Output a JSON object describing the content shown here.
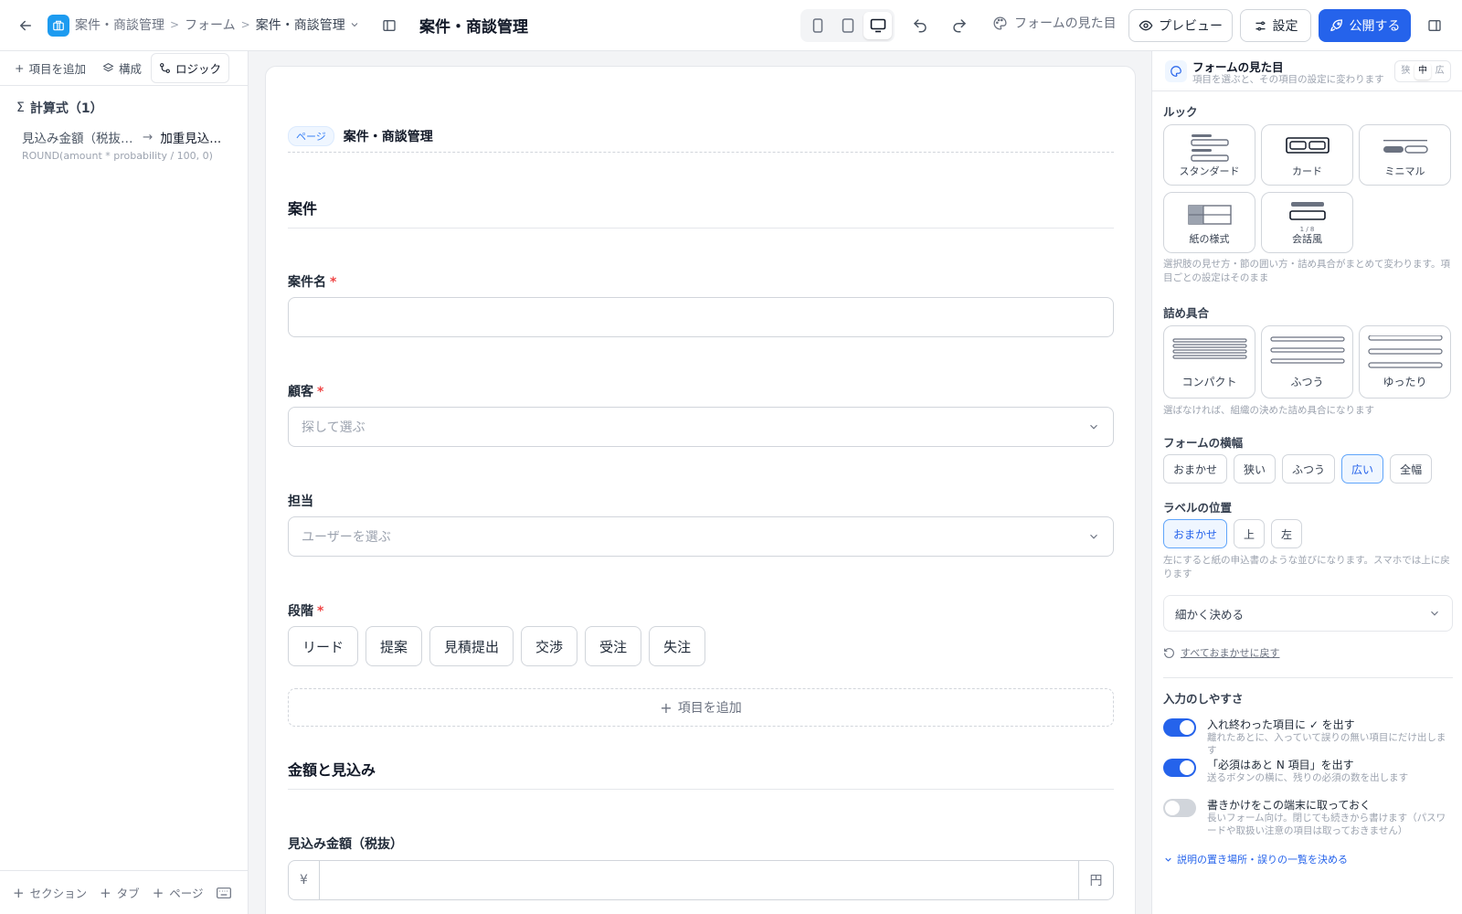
{
  "topbar": {
    "breadcrumb": [
      "案件・商談管理",
      "フォーム",
      "案件・商談管理"
    ],
    "title": "案件・商談管理",
    "look_label": "フォームの見た目",
    "preview_label": "プレビュー",
    "settings_label": "設定",
    "publish_label": "公開する",
    "active_device": "desktop",
    "accent": "#2563eb"
  },
  "left": {
    "tabs": [
      "項目を追加",
      "構成",
      "ロジック"
    ],
    "active_tab": "ロジック",
    "formula_head": "計算式（1）",
    "formula": {
      "source": "見込み金額（税抜）...",
      "target": "加重見込...",
      "expression": "ROUND(amount * probability / 100, 0)"
    },
    "bottom": [
      "セクション",
      "タブ",
      "ページ"
    ]
  },
  "canvas": {
    "page_pill": "ページ",
    "page_name": "案件・商談管理",
    "section1": "案件",
    "field_name_label": "案件名",
    "field_customer_label": "顧客",
    "field_customer_placeholder": "探して選ぶ",
    "field_owner_label": "担当",
    "field_owner_placeholder": "ユーザーを選ぶ",
    "field_stage_label": "段階",
    "stage_options": [
      "リード",
      "提案",
      "見積提出",
      "交渉",
      "受注",
      "失注"
    ],
    "add_item_label": "項目を追加",
    "section2": "金額と見込み",
    "field_amount_label": "見込み金額（税抜）",
    "amount_prefix": "¥",
    "amount_suffix": "円",
    "required_mark": "*"
  },
  "right": {
    "title": "フォームの見た目",
    "subtitle": "項目を選ぶと、その項目の設定に変わります",
    "density_seg": [
      "狭",
      "中",
      "広"
    ],
    "density_seg_selected": "中",
    "look_label": "ルック",
    "looks": [
      "スタンダード",
      "カード",
      "ミニマル",
      "紙の様式",
      "会話風"
    ],
    "look_help": "選択肢の見せ方・節の囲い方・詰め具合がまとめて変わります。項目ごとの設定はそのまま",
    "conversation_counter": "1 / 8",
    "spacing_label": "詰め具合",
    "spacings": [
      "コンパクト",
      "ふつう",
      "ゆったり"
    ],
    "spacing_help": "選ばなければ、組織の決めた詰め具合になります",
    "width_label": "フォームの横幅",
    "widths": [
      "おまかせ",
      "狭い",
      "ふつう",
      "広い",
      "全幅"
    ],
    "width_selected": "広い",
    "label_pos_label": "ラベルの位置",
    "label_positions": [
      "おまかせ",
      "上",
      "左"
    ],
    "label_pos_selected": "おまかせ",
    "label_pos_help": "左にすると紙の申込書のような並びになります。スマホでは上に戻ります",
    "detail_select": "細かく決める",
    "reset_link": "すべておまかせに戻す",
    "ease_label": "入力のしやすさ",
    "toggles": [
      {
        "title": "入れ終わった項目に ✓ を出す",
        "desc": "離れたあとに、入っていて誤りの無い項目にだけ出します",
        "on": true
      },
      {
        "title": "「必須はあと N 項目」を出す",
        "desc": "送るボタンの横に、残りの必須の数を出します",
        "on": true
      },
      {
        "title": "書きかけをこの端末に取っておく",
        "desc": "長いフォーム向け。閉じても続きから書けます（パスワードや取扱い注意の項目は取っておきません）",
        "on": false
      }
    ],
    "expand_link": "説明の置き場所・誤りの一覧を決める"
  }
}
